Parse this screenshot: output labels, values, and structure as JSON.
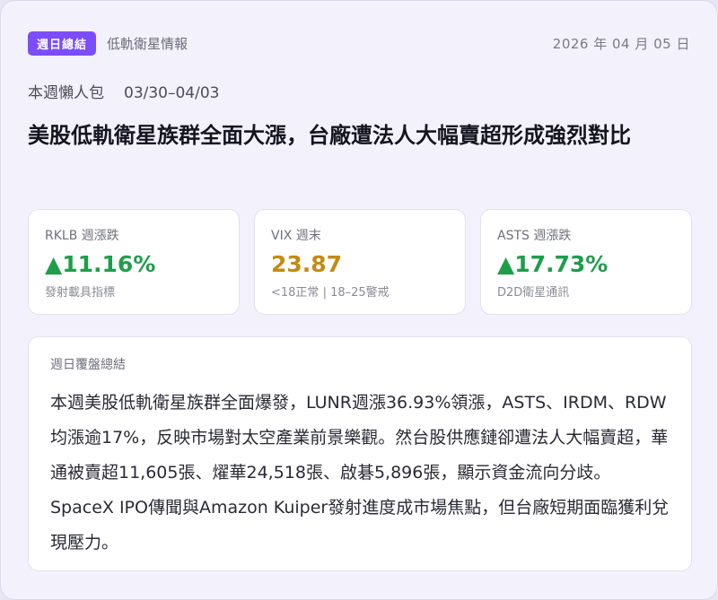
{
  "header": {
    "badge": "週日總結",
    "category": "低軌衛星情報",
    "date": "2026 年 04 月 05 日"
  },
  "subtitle": {
    "label": "本週懶人包",
    "range": "03/30–04/03"
  },
  "headline": "美股低軌衛星族群全面大漲，台廠遭法人大幅賣超形成強烈對比",
  "stats": [
    {
      "label": "RKLB 週漲跌",
      "value": "▲11.16%",
      "note": "發射載具指標",
      "tone": "up"
    },
    {
      "label": "VIX 週末",
      "value": "23.87",
      "note": "<18正常 | 18–25警戒",
      "tone": "warn"
    },
    {
      "label": "ASTS 週漲跌",
      "value": "▲17.73%",
      "note": "D2D衛星通訊",
      "tone": "up"
    }
  ],
  "colors": {
    "accent": "#7c4dff",
    "up": "#1e9e4a",
    "warn": "#c48a12"
  },
  "summary": {
    "title": "週日覆盤總結",
    "body": "本週美股低軌衛星族群全面爆發，LUNR週漲36.93%領漲，ASTS、IRDM、RDW均漲逾17%，反映市場對太空產業前景樂觀。然台股供應鏈卻遭法人大幅賣超，華通被賣超11,605張、燿華24,518張、啟碁5,896張，顯示資金流向分歧。SpaceX IPO傳聞與Amazon Kuiper發射進度成市場焦點，但台廠短期面臨獲利兌現壓力。"
  }
}
